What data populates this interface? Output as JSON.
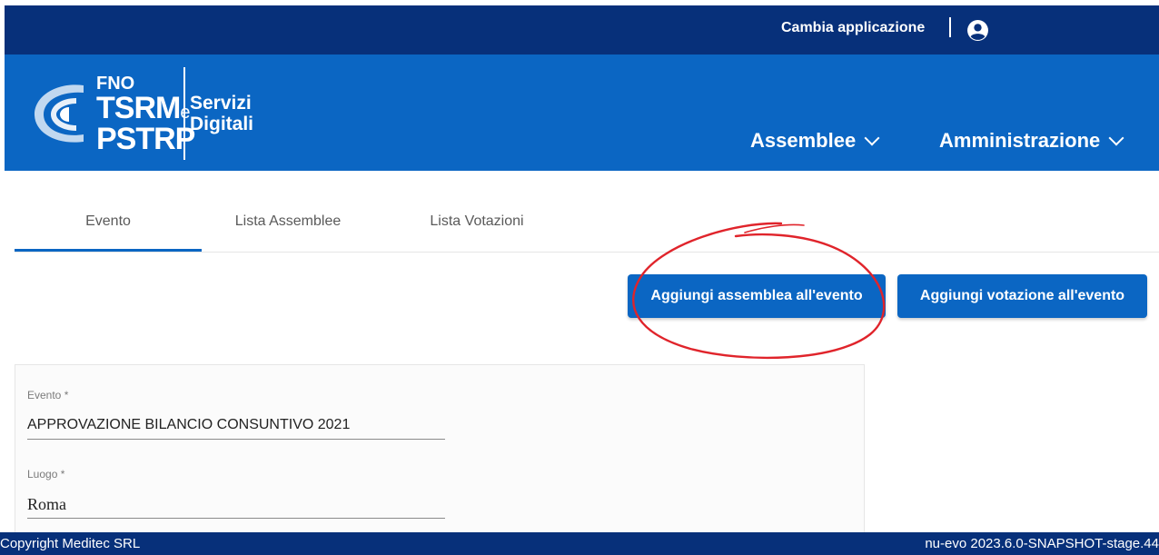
{
  "topbar": {
    "switch_app_label": "Cambia applicazione"
  },
  "header": {
    "logo": {
      "line1": "FNO",
      "line2": "TSRM",
      "line2_suffix": "e",
      "line3": "PSTRP"
    },
    "service_line1": "Servizi",
    "service_line2": "Digitali",
    "nav": [
      {
        "label": "Assemblee"
      },
      {
        "label": "Amministrazione"
      }
    ]
  },
  "tabs": [
    {
      "label": "Evento",
      "active": true
    },
    {
      "label": "Lista Assemblee",
      "active": false
    },
    {
      "label": "Lista Votazioni",
      "active": false
    }
  ],
  "actions": {
    "add_assembly": "Aggiungi assemblea all'evento",
    "add_vote": "Aggiungi votazione all'evento"
  },
  "form": {
    "evento_label": "Evento *",
    "evento_value": "APPROVAZIONE BILANCIO CONSUNTIVO 2021",
    "luogo_label": "Luogo *",
    "luogo_value": "Roma"
  },
  "footer": {
    "copyright": "Copyright Meditec SRL",
    "version": "nu-evo 2023.6.0-SNAPSHOT-stage.44"
  },
  "colors": {
    "topbar": "#07307a",
    "header": "#0b66c3",
    "accent": "#0b66c3",
    "annotation": "#e0242b"
  },
  "icons": {
    "user": "account-circle-icon",
    "chevron": "chevron-down-icon"
  }
}
